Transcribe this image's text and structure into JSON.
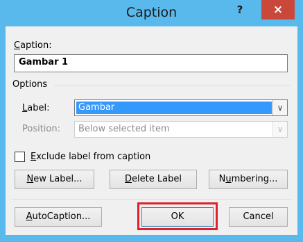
{
  "window": {
    "title": "Caption",
    "help_label": "?",
    "close_label": "×"
  },
  "caption_field": {
    "label": "Caption:",
    "value": "Gambar 1"
  },
  "options": {
    "title": "Options",
    "label_field": {
      "label": "Label:",
      "value": "Gambar"
    },
    "position_field": {
      "label": "Position:",
      "value": "Below selected item"
    },
    "exclude_checkbox": {
      "label": "Exclude label from caption",
      "checked": false
    }
  },
  "buttons": {
    "new_label": "New Label...",
    "delete_label": "Delete Label",
    "numbering": "Numbering...",
    "autocaption": "AutoCaption...",
    "ok": "OK",
    "cancel": "Cancel"
  },
  "icons": {
    "dropdown_arrow": "chevron-down-icon"
  },
  "colors": {
    "titlebar": "#59b9ec",
    "close_button": "#c9483a",
    "selection": "#3399ff",
    "highlight": "#e0202a"
  }
}
